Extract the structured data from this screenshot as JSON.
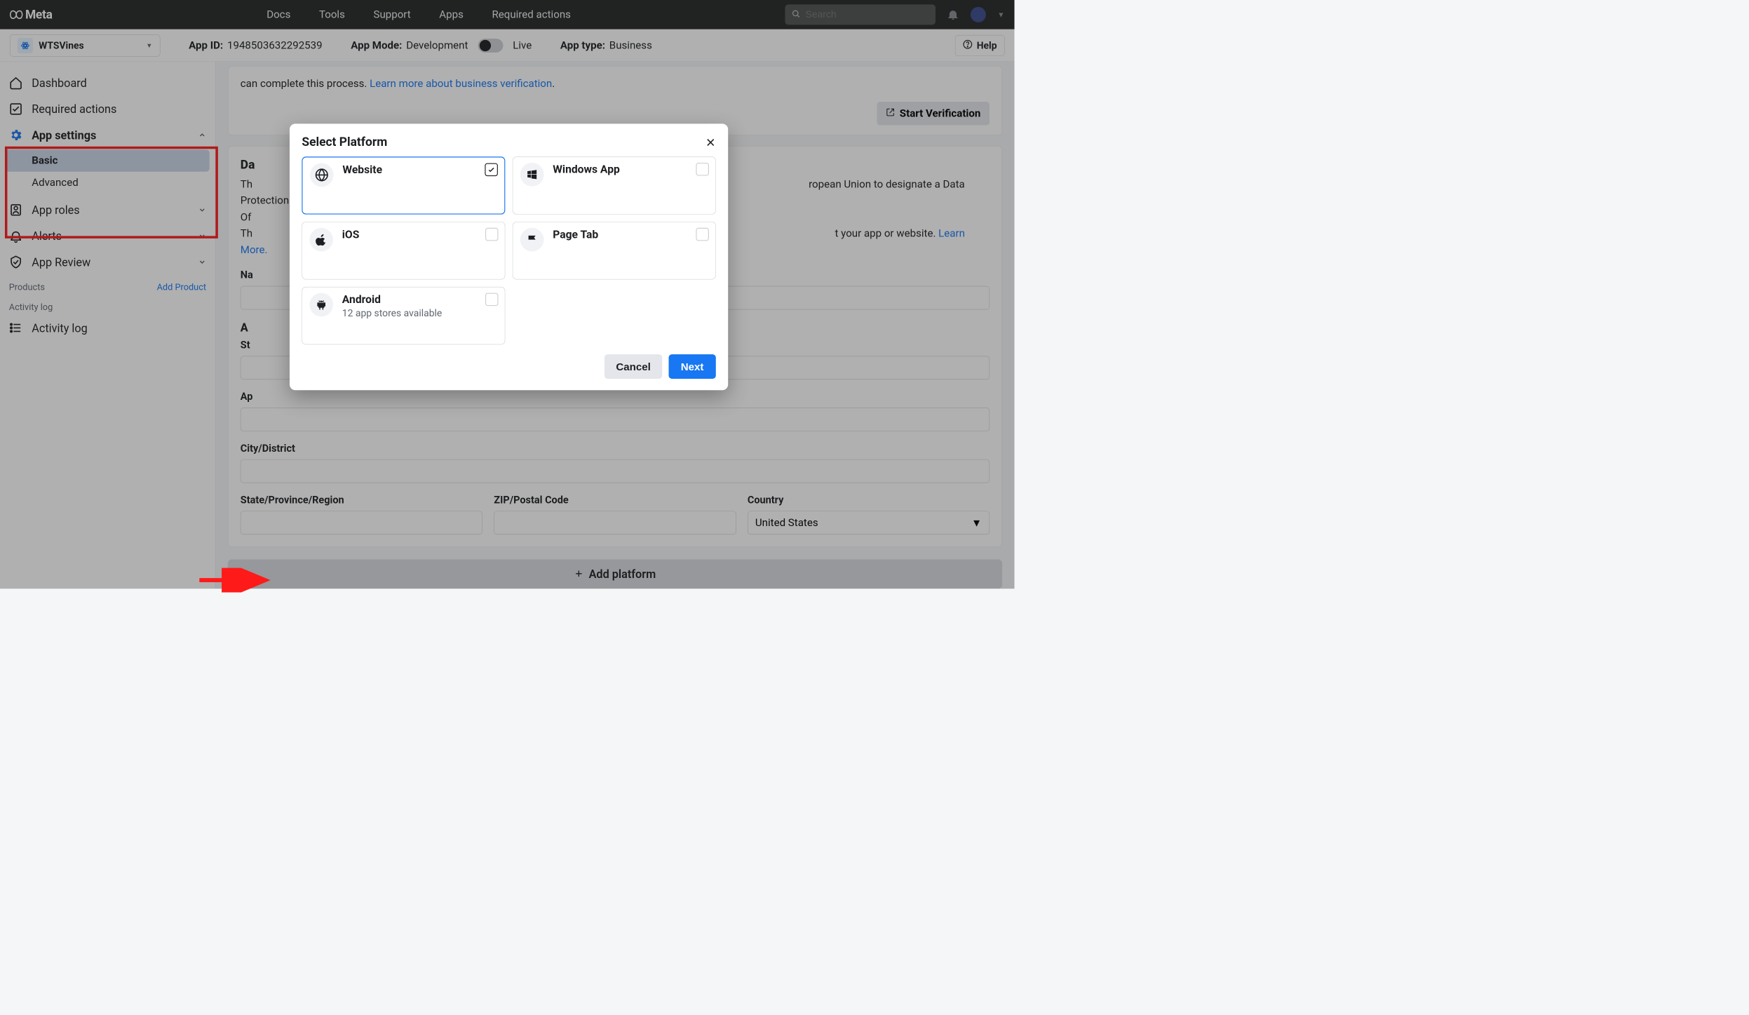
{
  "topnav": {
    "logo_text": "Meta",
    "links": [
      "Docs",
      "Tools",
      "Support",
      "Apps",
      "Required actions"
    ],
    "search_placeholder": "Search"
  },
  "appbar": {
    "app_name": "WTSVines",
    "appid_label": "App ID:",
    "appid_value": "1948503632292539",
    "mode_label": "App Mode:",
    "mode_value": "Development",
    "live_label": "Live",
    "type_label": "App type:",
    "type_value": "Business",
    "help_label": "Help"
  },
  "sidebar": {
    "items": [
      {
        "label": "Dashboard"
      },
      {
        "label": "Required actions"
      },
      {
        "label": "App settings",
        "children": [
          {
            "label": "Basic",
            "selected": true
          },
          {
            "label": "Advanced"
          }
        ]
      },
      {
        "label": "App roles"
      },
      {
        "label": "Alerts"
      },
      {
        "label": "App Review"
      }
    ],
    "products_heading": "Products",
    "add_product": "Add Product",
    "activity_heading": "Activity log",
    "activity_item": "Activity log"
  },
  "verify_card": {
    "text_prefix": "can complete this process. ",
    "link_text": "Learn more about business verification",
    "button": "Start Verification"
  },
  "form": {
    "heading_dpo": "Da",
    "dpo_body_prefix": "Th",
    "dpo_body_line2": "Of",
    "dpo_body_line3_prefix": "Th",
    "dpo_body_suffix": "ropean Union to designate a Data Protection",
    "dpo_body_tail": "t your app or website. ",
    "learn_more": "Learn More.",
    "name_label": "Na",
    "address_label": "A",
    "street_label": "St",
    "apt_label": "Ap",
    "city_label": "City/District",
    "state_label": "State/Province/Region",
    "zip_label": "ZIP/Postal Code",
    "country_label": "Country",
    "country_value": "United States"
  },
  "add_platform_button": "Add platform",
  "modal": {
    "title": "Select Platform",
    "platforms": [
      {
        "label": "Website",
        "sub": "",
        "selected": true
      },
      {
        "label": "Windows App",
        "sub": ""
      },
      {
        "label": "iOS",
        "sub": ""
      },
      {
        "label": "Page Tab",
        "sub": ""
      },
      {
        "label": "Android",
        "sub": "12 app stores available"
      }
    ],
    "cancel": "Cancel",
    "next": "Next"
  }
}
